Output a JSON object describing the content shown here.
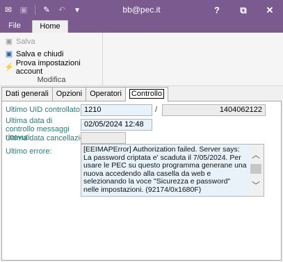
{
  "window": {
    "title": "bb@pec.it",
    "help": "?",
    "restore": "⧉",
    "close": "✕"
  },
  "ribbon_tabs": {
    "file": "File",
    "home": "Home"
  },
  "ribbon": {
    "save": "Salva",
    "save_close": "Salva e chiudi",
    "test_settings": "Prova impostazioni account",
    "group_label": "Modifica"
  },
  "tabs": [
    "Dati generali",
    "Opzioni",
    "Operatori",
    "Controllo"
  ],
  "form": {
    "last_uid_label": "Ultimo UID controllato:",
    "last_uid_value": "1210",
    "last_uid_total": "1404062122",
    "last_check_label": "Ultima data di controllo messaggi ricevuti",
    "last_check_value": "02/05/2024 12:48",
    "last_delete_label": "Ultima data cancellazione:",
    "last_delete_value": "",
    "last_error_label": "Ultimo errore:",
    "last_error_value": "[EEIMAPError] Authorization failed. Server says: La password criptata e' scaduta il 7/05/2024. Per usare le PEC su questo programma generane una nuova accedendo alla casella da web e selezionando la voce \"Sicurezza e password\" nelle impostazioni. (92174/0x1680F)"
  },
  "colors": {
    "titlebar": "#7b5a8f",
    "label_teal": "#2b7a78",
    "field_bg": "#e8f2fa"
  }
}
